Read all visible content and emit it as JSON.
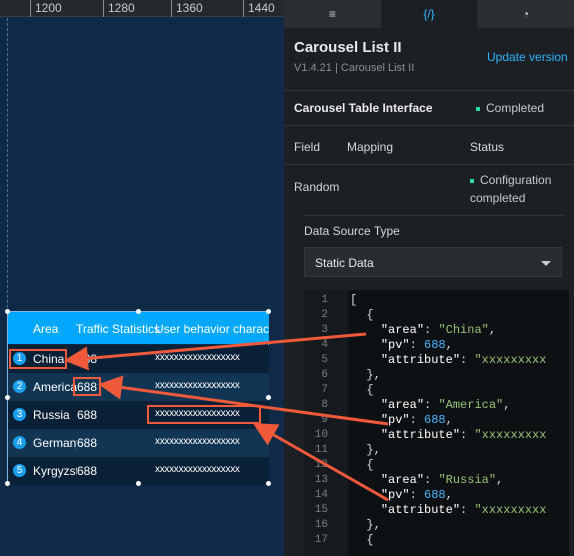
{
  "ruler": {
    "ticks": [
      "1200",
      "1280",
      "1360",
      "1440"
    ]
  },
  "table": {
    "headers": [
      "Area",
      "Traffic Statistics",
      "User behavior characte"
    ],
    "rows": [
      {
        "rank": "1",
        "area": "China",
        "pv": "688",
        "attr": "xxxxxxxxxxxxxxxxxx"
      },
      {
        "rank": "2",
        "area": "America",
        "pv": "688",
        "attr": "xxxxxxxxxxxxxxxxxx"
      },
      {
        "rank": "3",
        "area": "Russia",
        "pv": "688",
        "attr": "xxxxxxxxxxxxxxxxxx"
      },
      {
        "rank": "4",
        "area": "Germany",
        "pv": "688",
        "attr": "xxxxxxxxxxxxxxxxxx"
      },
      {
        "rank": "5",
        "area": "Kyrgyzst",
        "pv": "688",
        "attr": "xxxxxxxxxxxxxxxxxx"
      }
    ]
  },
  "tabs": [
    "style-tab",
    "data-tab",
    "interaction-tab"
  ],
  "tab_glyphs": [
    "≡",
    "{/}",
    "◔"
  ],
  "panel": {
    "title": "Carousel List II",
    "update_label": "Update version",
    "version": "V1.4.21 | Carousel List II",
    "interface_label": "Carousel Table Interface",
    "interface_status": "Completed",
    "field_label": "Field",
    "mapping_label": "Mapping",
    "status_label": "Status",
    "random_label": "Random",
    "config_status_line1": "Configuration",
    "config_status_line2": "completed",
    "datasource_label": "Data Source Type",
    "datasource_value": "Static Data"
  },
  "editor": {
    "line_numbers": [
      "1",
      "2",
      "3",
      "4",
      "5",
      "6",
      "7",
      "8",
      "9",
      "10",
      "11",
      "12",
      "13",
      "14",
      "15",
      "16",
      "17"
    ],
    "area_key": "\"area\"",
    "pv_key": "\"pv\"",
    "attr_key": "\"attribute\"",
    "area_values": [
      "\"China\"",
      "\"America\"",
      "\"Russia\""
    ],
    "pv_value": "688",
    "attr_value": "\"xxxxxxxxx"
  },
  "colors": {
    "accent": "#2fb5ff",
    "header": "#00a8ff",
    "highlight": "#f05a3a",
    "status_dot": "#2fd8a8"
  }
}
